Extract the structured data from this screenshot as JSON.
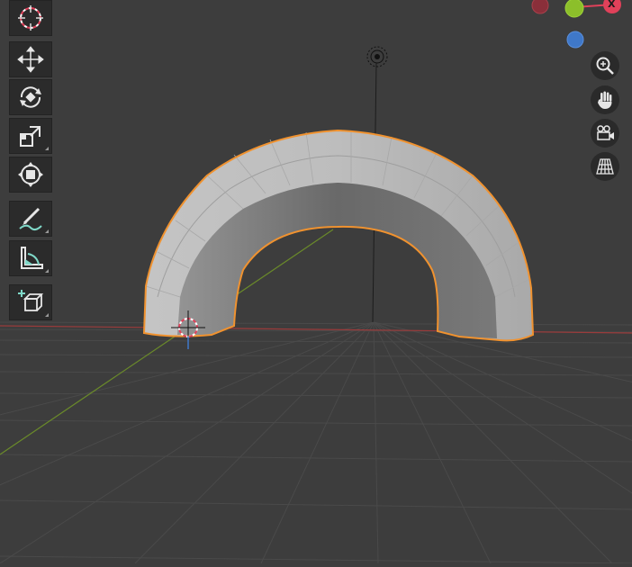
{
  "viewport": {
    "background": "#3d3d3d",
    "grid_color": "#4a4a4a",
    "x_axis_color": "#9b3b3b",
    "y_axis_color": "#6a8a2a",
    "selection_outline_color": "#f0922f"
  },
  "toolbar": {
    "tools": [
      {
        "name": "cursor",
        "icon": "cursor-icon"
      },
      {
        "name": "move",
        "icon": "move-icon"
      },
      {
        "name": "rotate",
        "icon": "rotate-icon"
      },
      {
        "name": "scale",
        "icon": "scale-icon"
      },
      {
        "name": "transform",
        "icon": "transform-icon"
      },
      {
        "name": "annotate",
        "icon": "annotate-icon"
      },
      {
        "name": "measure",
        "icon": "measure-icon"
      },
      {
        "name": "add-cube",
        "icon": "add-cube-icon"
      }
    ]
  },
  "gizmo": {
    "x_label": "X",
    "x_color": "#e0415a",
    "y_color": "#8cbf2a",
    "z_color": "#3f78c9",
    "neg_x_color": "#8a2f3a"
  },
  "nav": {
    "buttons": [
      {
        "name": "zoom",
        "icon": "zoom-icon"
      },
      {
        "name": "pan",
        "icon": "hand-icon"
      },
      {
        "name": "camera",
        "icon": "camera-icon"
      },
      {
        "name": "perspective",
        "icon": "grid-icon"
      }
    ]
  }
}
